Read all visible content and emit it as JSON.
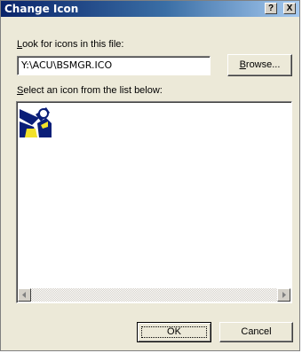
{
  "dialog": {
    "title": "Change Icon",
    "help_button": "?",
    "close_button": "X"
  },
  "file_section": {
    "label_prefix": "",
    "label_accesskey": "L",
    "label_rest": "ook for icons in this file:",
    "file_value": "Y:\\ACU\\BSMGR.ICO",
    "browse_accesskey": "B",
    "browse_rest": "rowse..."
  },
  "icon_section": {
    "label_accesskey": "S",
    "label_rest": "elect an icon from the list below:",
    "icons": [
      {
        "name": "bsmgr-icon",
        "selected": false
      }
    ]
  },
  "buttons": {
    "ok": "OK",
    "cancel": "Cancel"
  },
  "colors": {
    "titlebar_start": "#0a246a",
    "titlebar_end": "#a6caf0",
    "dialog_bg": "#ece9d8",
    "icon_navy": "#0a1e78",
    "icon_yellow": "#f2e12a"
  }
}
